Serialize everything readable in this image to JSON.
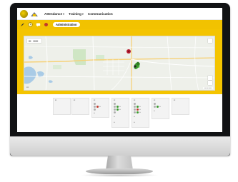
{
  "nav": {
    "items": [
      {
        "label": "Attendance",
        "caret": "▾"
      },
      {
        "label": "Training",
        "caret": "▾"
      },
      {
        "label": "Communication",
        "caret": ""
      }
    ]
  },
  "toolbar": {
    "admin_label": "Administration"
  },
  "colors": {
    "brand_yellow": "#f2c200",
    "status_green": "#3a9a2e",
    "status_red": "#c0392b"
  },
  "icons": [
    "app-logo-icon",
    "home-icon",
    "pin-icon",
    "clock-icon",
    "message-icon",
    "alert-icon"
  ]
}
